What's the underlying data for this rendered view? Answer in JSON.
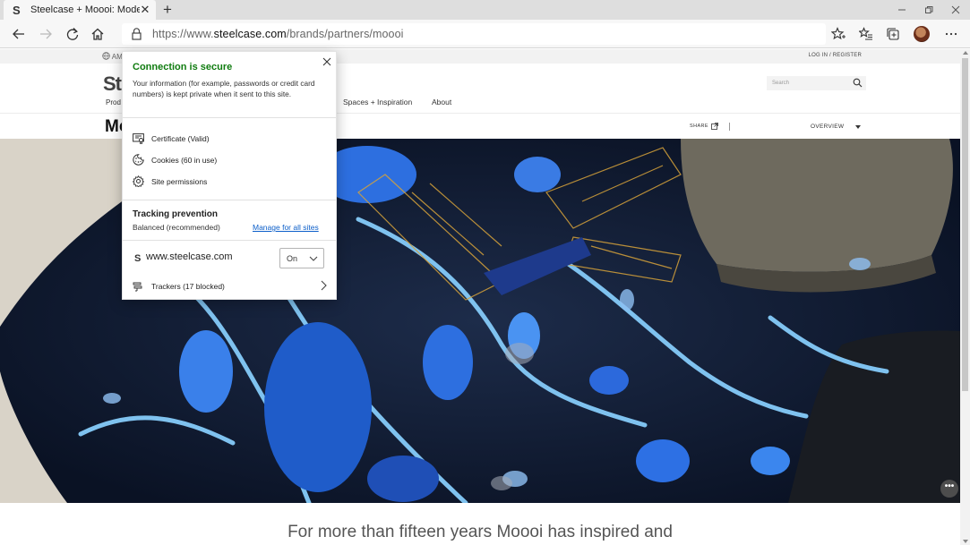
{
  "browser": {
    "tab": {
      "favicon": "S",
      "title": "Steelcase + Moooi: Modern ...",
      "close": "✕"
    },
    "new_tab": "+",
    "url_prefix": "https://www.",
    "url_host": "steelcase.com",
    "url_path": "/brands/partners/moooi"
  },
  "site": {
    "util_bar": {
      "region": "AM",
      "login": "LOG IN / REGISTER"
    },
    "logo": "St",
    "products_short": "Prod",
    "nav": [
      "Spaces + Inspiration",
      "About"
    ],
    "search_placeholder": "Search",
    "page_title_short": "Mo",
    "share": "SHARE",
    "overview": "OVERVIEW",
    "more": "•••",
    "caption": "For more than fifteen years Moooi has inspired and"
  },
  "security_flyout": {
    "heading": "Connection is secure",
    "description": "Your information (for example, passwords or credit card numbers) is kept private when it sent to this site.",
    "items": [
      {
        "label": "Certificate (Valid)",
        "icon": "certificate-icon"
      },
      {
        "label": "Cookies (60 in use)",
        "icon": "cookie-icon"
      },
      {
        "label": "Site permissions",
        "icon": "gear-icon"
      }
    ],
    "tracking": {
      "heading": "Tracking prevention",
      "level": "Balanced (recommended)",
      "manage_link": "Manage for all sites",
      "site_favicon": "S",
      "site": "www.steelcase.com",
      "state": "On",
      "trackers": "Trackers (17 blocked)"
    },
    "heading_color": "#107c10",
    "link_color": "#0b5ec9"
  }
}
